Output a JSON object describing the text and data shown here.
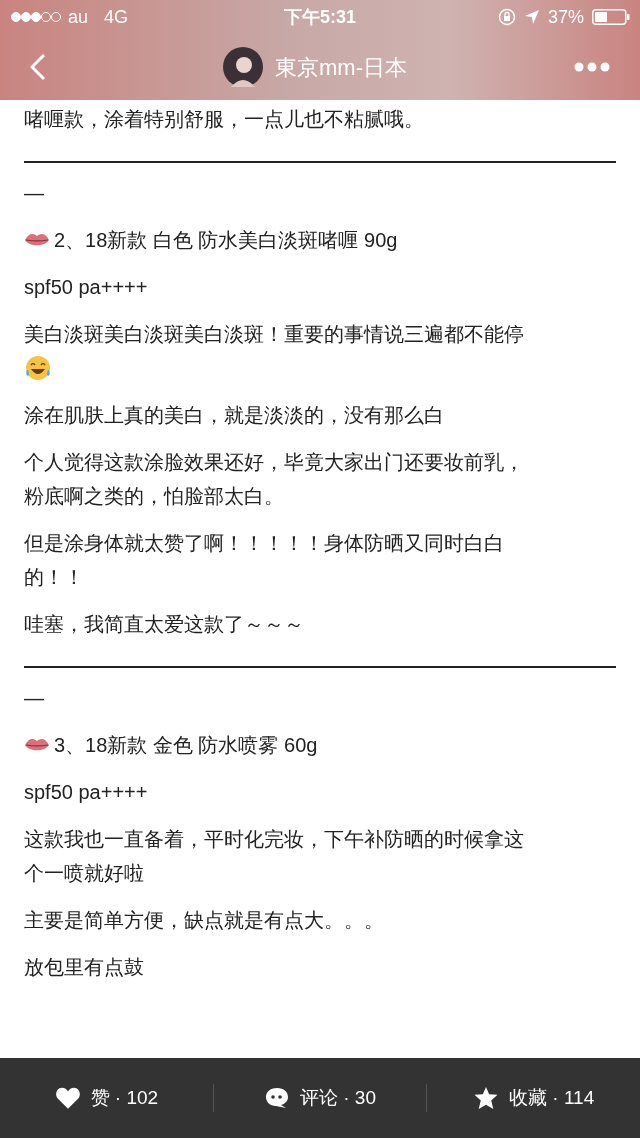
{
  "status_bar": {
    "carrier": "au",
    "network": "4G",
    "time": "下午5:31",
    "battery": "37%"
  },
  "nav": {
    "title": "東京mm-日本"
  },
  "content": [
    {
      "kind": "paragraph",
      "lines": [
        "啫喱款，涂着特别舒服，一点儿也不粘腻哦。"
      ]
    },
    {
      "kind": "divider"
    },
    {
      "kind": "paragraph",
      "lines": [
        "—"
      ]
    },
    {
      "kind": "heading",
      "lines": [
        "2、18新款 白色 防水美白淡斑啫喱 90g"
      ]
    },
    {
      "kind": "paragraph",
      "lines": [
        "spf50 pa++++"
      ]
    },
    {
      "kind": "paragraph",
      "lines": [
        "美白淡斑美白淡斑美白淡斑！重要的事情说三遍都不能停"
      ]
    },
    {
      "kind": "emoji"
    },
    {
      "kind": "paragraph",
      "lines": [
        "涂在肌肤上真的美白，就是淡淡的，没有那么白"
      ]
    },
    {
      "kind": "paragraph",
      "lines": [
        "个人觉得这款涂脸效果还好，毕竟大家出门还要妆前乳，",
        "粉底啊之类的，怕脸部太白。"
      ]
    },
    {
      "kind": "paragraph",
      "lines": [
        "但是涂身体就太赞了啊！！！！！身体防晒又同时白白",
        "的！！"
      ]
    },
    {
      "kind": "paragraph",
      "lines": [
        "哇塞，我简直太爱这款了～～～"
      ]
    },
    {
      "kind": "divider"
    },
    {
      "kind": "paragraph",
      "lines": [
        "—"
      ]
    },
    {
      "kind": "heading",
      "lines": [
        "3、18新款 金色 防水喷雾 60g"
      ]
    },
    {
      "kind": "paragraph",
      "lines": [
        "spf50 pa++++"
      ]
    },
    {
      "kind": "paragraph",
      "lines": [
        "这款我也一直备着，平时化完妆，下午补防晒的时候拿这",
        "个一喷就好啦"
      ]
    },
    {
      "kind": "paragraph",
      "lines": [
        "主要是简单方便，缺点就是有点大。。。"
      ]
    },
    {
      "kind": "paragraph",
      "lines": [
        "放包里有点鼓"
      ]
    }
  ],
  "actions": [
    {
      "kind": "like",
      "label": "赞 · 102"
    },
    {
      "kind": "comment",
      "label": "评论 · 30"
    },
    {
      "kind": "favorite",
      "label": "收藏 · 114"
    }
  ]
}
